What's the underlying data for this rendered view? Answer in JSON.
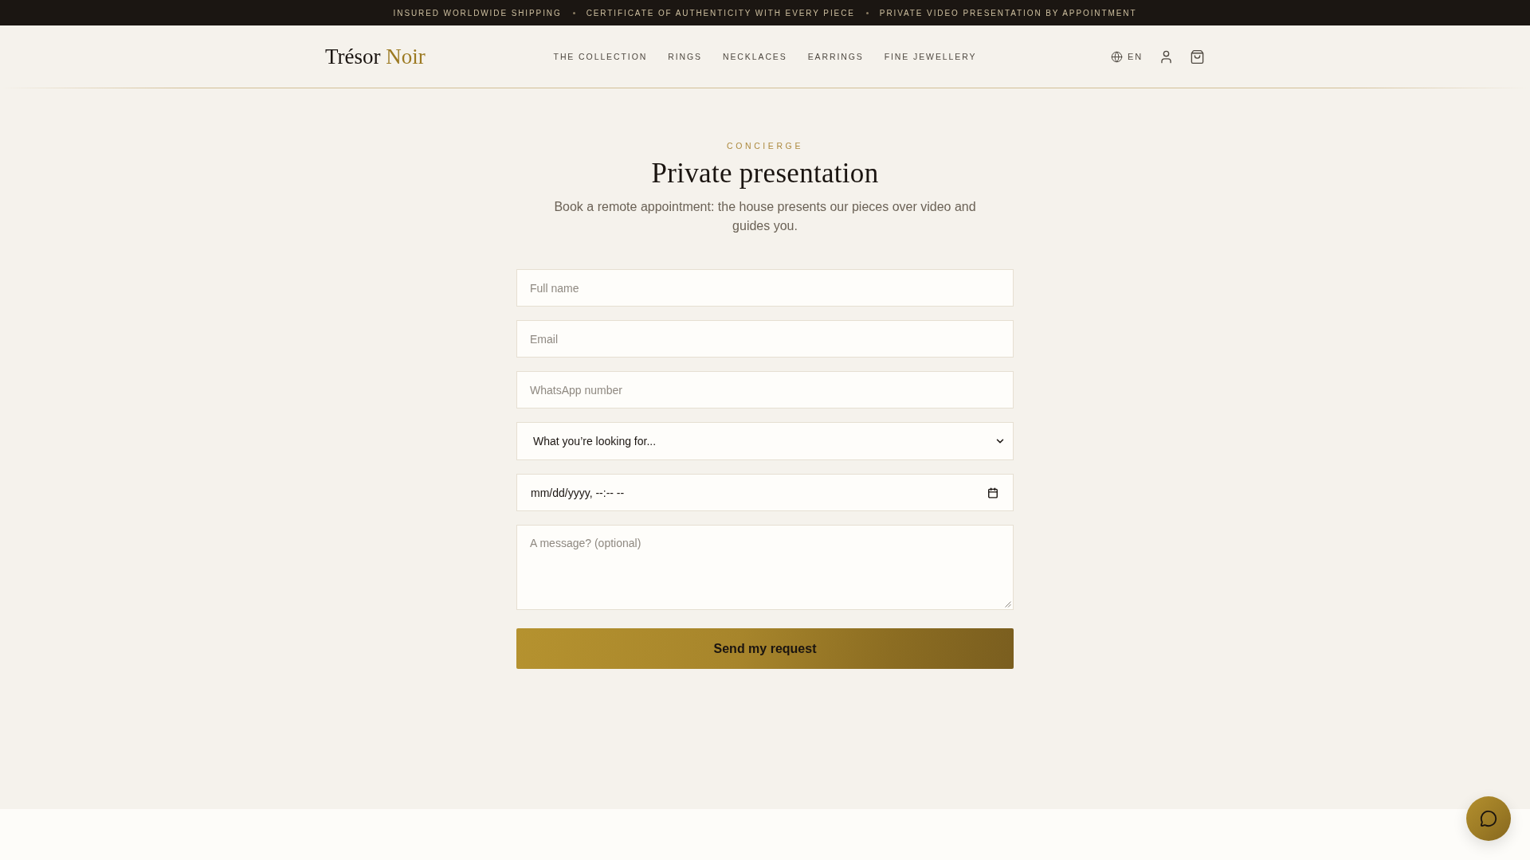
{
  "announcement_bar": {
    "messages": [
      "INSURED WORLDWIDE SHIPPING",
      "CERTIFICATE OF AUTHENTICITY WITH EVERY PIECE",
      "PRIVATE VIDEO PRESENTATION BY APPOINTMENT"
    ]
  },
  "header": {
    "logo": {
      "name": "Trésor",
      "accent": "Noir"
    },
    "nav": [
      "THE COLLECTION",
      "RINGS",
      "NECKLACES",
      "EARRINGS",
      "FINE JEWELLERY"
    ],
    "language": "EN"
  },
  "intro": {
    "eyebrow": "CONCIERGE",
    "title": "Private presentation",
    "subtitle": "Book a remote appointment: the house presents our pieces over video and guides you."
  },
  "form": {
    "fields": [
      {
        "kind": "text",
        "placeholder": "Full name"
      },
      {
        "kind": "text",
        "placeholder": "Email"
      },
      {
        "kind": "text",
        "placeholder": "WhatsApp number"
      },
      {
        "kind": "select",
        "value": "What you’re looking for..."
      },
      {
        "kind": "datetime",
        "mask": "mm/dd/yyyy, --:-- --"
      },
      {
        "kind": "textarea",
        "placeholder": "A message? (optional)"
      }
    ],
    "submit": "Send my request"
  }
}
